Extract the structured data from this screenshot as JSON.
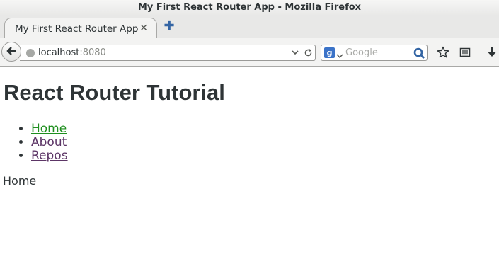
{
  "window": {
    "title": "My First React Router App - Mozilla Firefox"
  },
  "tabs": [
    {
      "label": "My First React Router App",
      "close_icon": "close-icon",
      "active": true
    }
  ],
  "toolbar": {
    "url_host": "localhost",
    "url_port": ":8080",
    "search_placeholder": "Google",
    "search_engine_icon": "google-icon",
    "search_engine_letter": "g"
  },
  "page": {
    "title": "React Router Tutorial",
    "nav_links": [
      {
        "label": "Home"
      },
      {
        "label": "About"
      },
      {
        "label": "Repos"
      }
    ],
    "route_content": "Home"
  },
  "colors": {
    "active_link": "#1f8f1f",
    "visited_link": "#5c3566",
    "new_tab_plus": "#3465a4",
    "search_go": "#3465a4"
  }
}
